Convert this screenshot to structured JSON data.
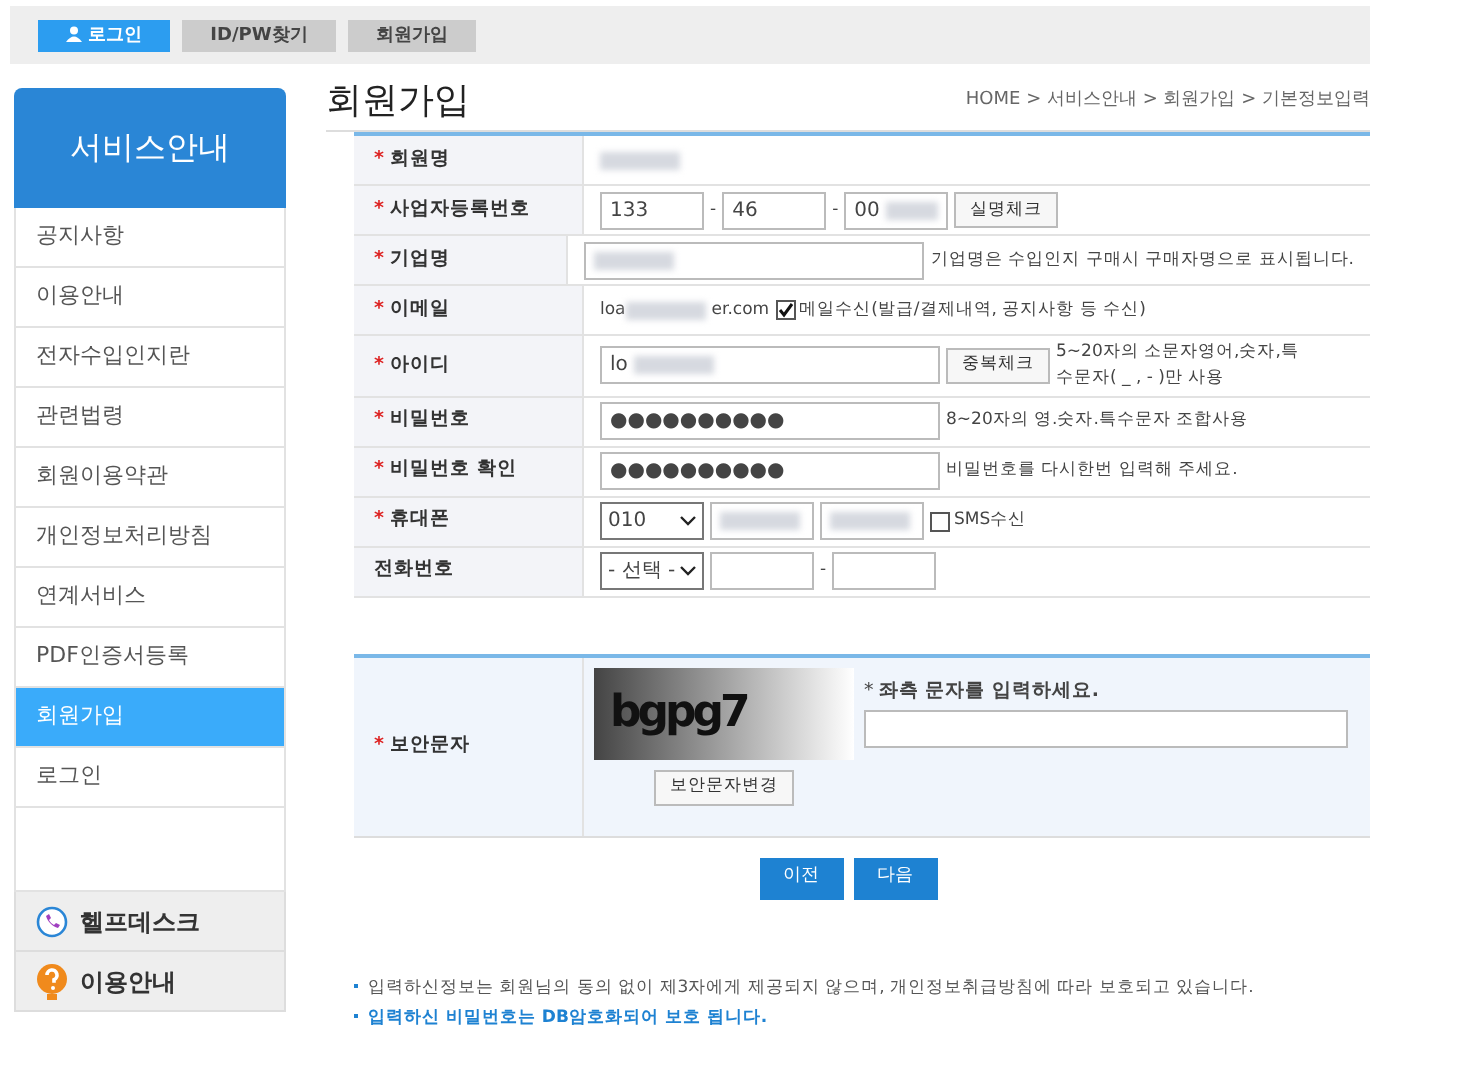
{
  "top_nav": [
    {
      "label": "로그인",
      "selected": true,
      "kind": "with_icon"
    },
    {
      "label": "ID/PW찾기",
      "selected": false
    },
    {
      "label": "회원가입",
      "selected": false
    }
  ],
  "sidebar": {
    "title": "서비스안내",
    "items": [
      {
        "label": "공지사항",
        "selected": false
      },
      {
        "label": "이용안내",
        "selected": false
      },
      {
        "label": "전자수입인지란",
        "selected": false
      },
      {
        "label": "관련법령",
        "selected": false
      },
      {
        "label": "회원이용약관",
        "selected": false
      },
      {
        "label": "개인정보처리방침",
        "selected": false
      },
      {
        "label": "연계서비스",
        "selected": false
      },
      {
        "label": "PDF인증서등록",
        "selected": false
      },
      {
        "label": "회원가입",
        "selected": true
      },
      {
        "label": "로그인",
        "selected": false
      }
    ],
    "panels": [
      {
        "label": "헬프데스크",
        "kind": "phone"
      },
      {
        "label": "이용안내",
        "kind": "help"
      }
    ]
  },
  "page": {
    "title": "회원가입",
    "breadcrumb": "HOME > 서비스안내 > 회원가입 > 기본정보입력"
  },
  "required_mark": "*",
  "form_rows": [
    {
      "label": "회원명",
      "required": true,
      "controls": [
        {
          "kind": "text",
          "blurred": true
        }
      ]
    },
    {
      "label": "사업자등록번호",
      "required": true,
      "controls": [
        {
          "kind": "input_short",
          "value": "133",
          "blurred": false
        },
        {
          "kind": "sep",
          "text": "-"
        },
        {
          "kind": "input_short",
          "value": "46",
          "blurred": false
        },
        {
          "kind": "sep",
          "text": "-"
        },
        {
          "kind": "input_short",
          "value": "00",
          "blurred": true
        },
        {
          "kind": "button",
          "label": "실명체크"
        }
      ]
    },
    {
      "label": "기업명",
      "required": true,
      "controls": [
        {
          "kind": "input_long",
          "blurred": true
        },
        {
          "kind": "note",
          "text": "기업명은 수입인지 구매시 구매자명으로 표시됩니다."
        }
      ]
    },
    {
      "label": "이메일",
      "required": true,
      "controls": [
        {
          "kind": "text",
          "value": "loa",
          "blurred": true
        },
        {
          "kind": "text",
          "value": "er.com",
          "blurred": false
        },
        {
          "kind": "checkbox",
          "label": "메일수신(발급/결제내역, 공지사항 등 수신)",
          "checked": true
        }
      ]
    },
    {
      "label": "아이디",
      "required": true,
      "controls": [
        {
          "kind": "input_long",
          "value": "lo",
          "blurred": true
        },
        {
          "kind": "button",
          "label": "중복체크"
        },
        {
          "kind": "note",
          "text": "5~20자의 소문자영어,숫자,특수문자( _ , - )만 사용"
        }
      ]
    },
    {
      "label": "비밀번호",
      "required": true,
      "controls": [
        {
          "kind": "input_long",
          "value": "●●●●●●●●●●",
          "blurred": false
        },
        {
          "kind": "note",
          "text": "8~20자의 영.숫자.특수문자 조합사용"
        }
      ]
    },
    {
      "label": "비밀번호 확인",
      "required": true,
      "controls": [
        {
          "kind": "input_long",
          "value": "●●●●●●●●●●",
          "blurred": false
        },
        {
          "kind": "note",
          "text": "비밀번호를 다시한번 입력해 주세요."
        }
      ]
    },
    {
      "label": "휴대폰",
      "required": true,
      "controls": [
        {
          "kind": "select",
          "value": "010"
        },
        {
          "kind": "input_short",
          "blurred": true
        },
        {
          "kind": "input_short",
          "blurred": true
        },
        {
          "kind": "checkbox",
          "label": "SMS수신",
          "checked": false
        }
      ]
    },
    {
      "label": "전화번호",
      "required": false,
      "controls": [
        {
          "kind": "select",
          "value": "- 선택 -"
        },
        {
          "kind": "input_short",
          "blurred": false
        },
        {
          "kind": "sep",
          "text": "-"
        },
        {
          "kind": "input_short",
          "blurred": false
        }
      ]
    }
  ],
  "captcha": {
    "label": "보안문자",
    "required": true,
    "image_text": "bgpg7",
    "prompt_mark": "*",
    "prompt": "좌측 문자를 입력하세요.",
    "refresh_button": "보안문자변경"
  },
  "buttons": [
    "이전",
    "다음"
  ],
  "notes": [
    {
      "text": "입력하신정보는 회원님의 동의 없이 제3자에게 제공되지 않으며, 개인정보취급방침에 따라 보호되고 있습니다.",
      "emphasis": false
    },
    {
      "text": "입력하신 비밀번호는 DB암호화되어 보호 됩니다.",
      "emphasis": true
    }
  ]
}
